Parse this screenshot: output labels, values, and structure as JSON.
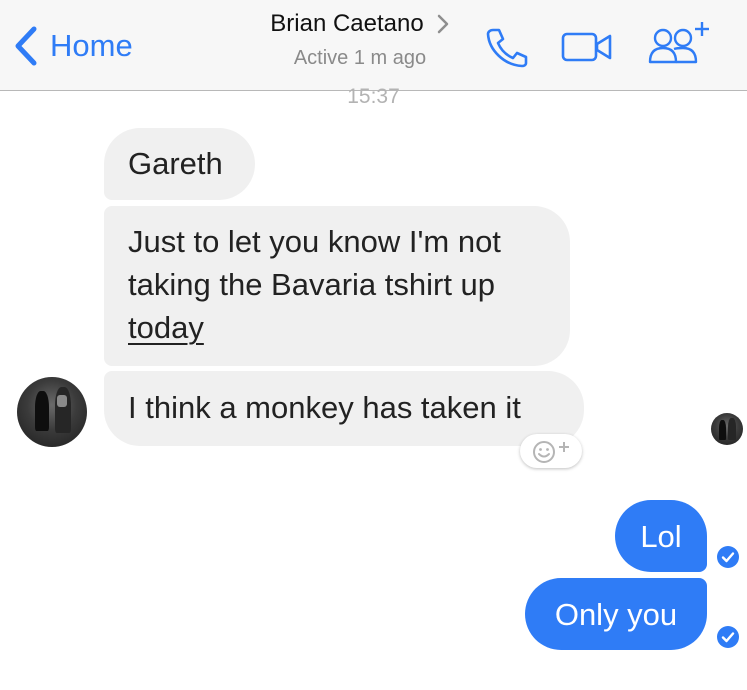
{
  "header": {
    "back_label": "Home",
    "contact_name": "Brian Caetano",
    "active_status": "Active 1 m ago"
  },
  "conversation": {
    "timestamp": "15:37",
    "incoming": [
      {
        "lines": [
          "Gareth"
        ]
      },
      {
        "lines": [
          "Just to let you know I'm not",
          "taking the Bavaria tshirt up"
        ],
        "underlined": "today"
      },
      {
        "lines": [
          "I think a monkey has taken it"
        ]
      }
    ],
    "outgoing": [
      {
        "text": "Lol"
      },
      {
        "text": "Only you"
      }
    ]
  },
  "icons": {
    "back": "chevron-left-icon",
    "contact_chevron": "chevron-right-icon",
    "call": "phone-icon",
    "video": "video-camera-icon",
    "add_people": "add-people-icon",
    "reaction": "add-reaction-icon",
    "delivered": "check-icon"
  },
  "colors": {
    "accent": "#2f7cf6",
    "incoming_bubble": "#f0f0f0",
    "header_bg": "#f7f7f7"
  }
}
